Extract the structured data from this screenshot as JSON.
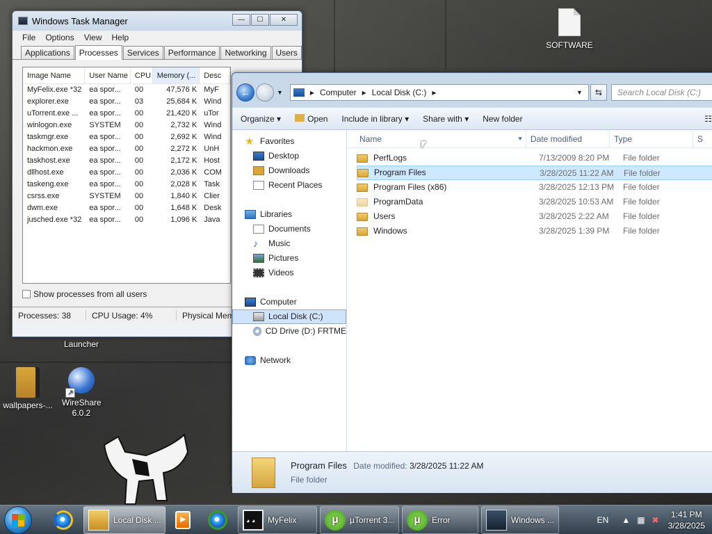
{
  "desktop": {
    "icons": [
      {
        "label": "SOFTWARE",
        "icon": "file-icon"
      },
      {
        "label": "Launcher",
        "icon": "launcher-icon"
      },
      {
        "label": "wallpapers-...",
        "icon": "folder-icon"
      },
      {
        "label": "WireShare 6.0.2",
        "icon": "wireshare-globe-icon"
      }
    ]
  },
  "task_manager": {
    "title": "Windows Task Manager",
    "menu": [
      "File",
      "Options",
      "View",
      "Help"
    ],
    "tabs": [
      "Applications",
      "Processes",
      "Services",
      "Performance",
      "Networking",
      "Users"
    ],
    "active_tab": "Processes",
    "columns": [
      "Image Name",
      "User Name",
      "CPU",
      "Memory (...",
      "Desc"
    ],
    "rows": [
      [
        "MyFelix.exe *32",
        "ea spor...",
        "00",
        "47,576 K",
        "MyF"
      ],
      [
        "explorer.exe",
        "ea spor...",
        "03",
        "25,684 K",
        "Wind"
      ],
      [
        "uTorrent.exe ...",
        "ea spor...",
        "00",
        "21,420 K",
        "uTor"
      ],
      [
        "winlogon.exe",
        "SYSTEM",
        "00",
        "2,732 K",
        "Wind"
      ],
      [
        "taskmgr.exe",
        "ea spor...",
        "00",
        "2,692 K",
        "Wind"
      ],
      [
        "hackmon.exe",
        "ea spor...",
        "00",
        "2,272 K",
        "UnH"
      ],
      [
        "taskhost.exe",
        "ea spor...",
        "00",
        "2,172 K",
        "Host"
      ],
      [
        "dllhost.exe",
        "ea spor...",
        "00",
        "2,036 K",
        "COM"
      ],
      [
        "taskeng.exe",
        "ea spor...",
        "00",
        "2,028 K",
        "Task"
      ],
      [
        "csrss.exe",
        "SYSTEM",
        "00",
        "1,840 K",
        "Clier"
      ],
      [
        "dwm.exe",
        "ea spor...",
        "00",
        "1,648 K",
        "Desk"
      ],
      [
        "jusched.exe *32",
        "ea spor...",
        "00",
        "1,096 K",
        "Java"
      ]
    ],
    "show_all_label": "Show processes from all users",
    "status": {
      "processes": "Processes: 38",
      "cpu": "CPU Usage: 4%",
      "memory": "Physical Memo"
    }
  },
  "explorer": {
    "breadcrumb": [
      "Computer",
      "Local Disk (C:)"
    ],
    "search_placeholder": "Search Local Disk (C:)",
    "toolbar": {
      "organize": "Organize",
      "open": "Open",
      "include": "Include in library",
      "share": "Share with",
      "new_folder": "New folder"
    },
    "nav": {
      "favorites": "Favorites",
      "desktop": "Desktop",
      "downloads": "Downloads",
      "recent": "Recent Places",
      "libraries": "Libraries",
      "documents": "Documents",
      "music": "Music",
      "pictures": "Pictures",
      "videos": "Videos",
      "computer": "Computer",
      "local_disk": "Local Disk (C:)",
      "cd_drive": "CD Drive (D:) FRTME",
      "network": "Network"
    },
    "columns": [
      "Name",
      "Date modified",
      "Type",
      "S"
    ],
    "files": [
      {
        "name": "PerfLogs",
        "date": "7/13/2009 8:20 PM",
        "type": "File folder"
      },
      {
        "name": "Program Files",
        "date": "3/28/2025 11:22 AM",
        "type": "File folder"
      },
      {
        "name": "Program Files (x86)",
        "date": "3/28/2025 12:13 PM",
        "type": "File folder"
      },
      {
        "name": "ProgramData",
        "date": "3/28/2025 10:53 AM",
        "type": "File folder"
      },
      {
        "name": "Users",
        "date": "3/28/2025 2:22 AM",
        "type": "File folder"
      },
      {
        "name": "Windows",
        "date": "3/28/2025 1:39 PM",
        "type": "File folder"
      }
    ],
    "details": {
      "name": "Program Files",
      "date_label": "Date modified:",
      "date_value": "3/28/2025 11:22 AM",
      "type": "File folder"
    }
  },
  "taskbar": {
    "buttons": [
      {
        "label": "Local Disk ...",
        "icon": "explorer-folder-icon"
      },
      {
        "label": "MyFelix",
        "icon": "felix-cat-icon"
      },
      {
        "label": "µTorrent 3...",
        "icon": "utorrent-icon"
      },
      {
        "label": "Error",
        "icon": "utorrent-icon"
      },
      {
        "label": "Windows ...",
        "icon": "task-manager-icon"
      }
    ],
    "lang": "EN",
    "time": "1:41 PM",
    "date": "3/28/2025"
  }
}
